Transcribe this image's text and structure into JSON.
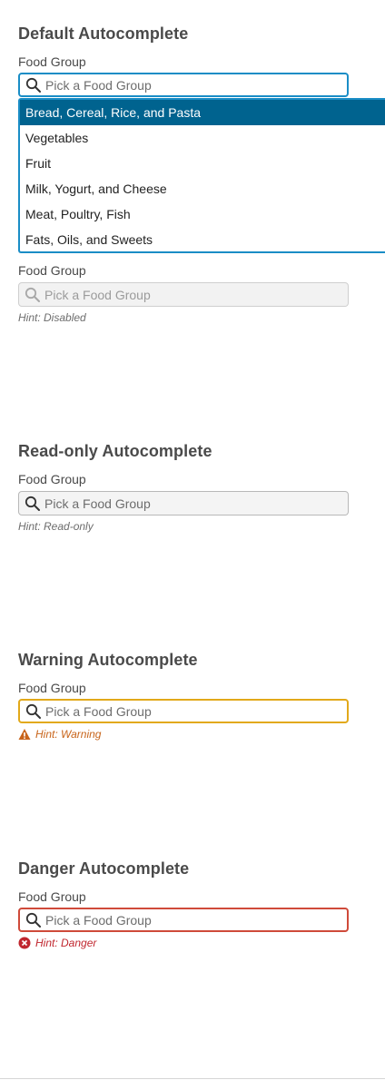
{
  "sections": [
    {
      "title": "Default Autocomplete",
      "label": "Food Group",
      "placeholder": "Pick a Food Group"
    },
    {
      "label": "Food Group",
      "placeholder": "Pick a Food Group",
      "hint": "Hint: Disabled"
    },
    {
      "title": "Read-only Autocomplete",
      "label": "Food Group",
      "placeholder": "Pick a Food Group",
      "hint": "Hint: Read-only"
    },
    {
      "title": "Warning Autocomplete",
      "label": "Food Group",
      "placeholder": "Pick a Food Group",
      "hint": "Hint: Warning"
    },
    {
      "title": "Danger Autocomplete",
      "label": "Food Group",
      "placeholder": "Pick a Food Group",
      "hint": "Hint: Danger"
    }
  ],
  "dropdown": {
    "options": [
      "Bread, Cereal, Rice, and Pasta",
      "Vegetables",
      "Fruit",
      "Milk, Yogurt, and Cheese",
      "Meat, Poultry, Fish",
      "Fats, Oils, and Sweets"
    ],
    "active_index": 0
  },
  "colors": {
    "focus": "#1a8dc6",
    "active_option": "#00638f",
    "warning": "#e2a91a",
    "warning_text": "#c8641a",
    "danger": "#cf4a3a",
    "danger_text": "#c0262e"
  },
  "icons": {
    "field": "search-icon",
    "warning_hint": "warning-triangle-icon",
    "danger_hint": "error-circle-icon"
  }
}
